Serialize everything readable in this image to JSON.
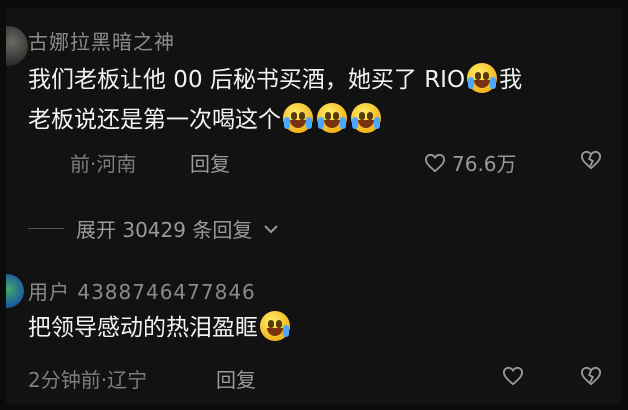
{
  "comments": [
    {
      "author": "古娜拉黑暗之神",
      "line1": "我们老板让他 00 后秘书买酒，她买了 RIO",
      "line2_a": "我",
      "line2_b": "老板说还是第一次喝这个",
      "meta": "前·河南",
      "reply_label": "回复",
      "likes": "76.6万",
      "replies_expand": "展开 30429 条回复"
    },
    {
      "author": "用户 4388746477846",
      "text": "把领导感动的热泪盈眶",
      "meta": "2分钟前·辽宁",
      "reply_label": "回复"
    }
  ],
  "icons": {
    "emoji": "crying-laughing-emoji",
    "like": "heart-icon",
    "dislike": "broken-heart-icon",
    "expand": "chevron-down-icon"
  },
  "colors": {
    "background": "#121212",
    "author": "#8a8a8a",
    "text": "#f2f2f2",
    "meta": "#7d7d7d"
  }
}
